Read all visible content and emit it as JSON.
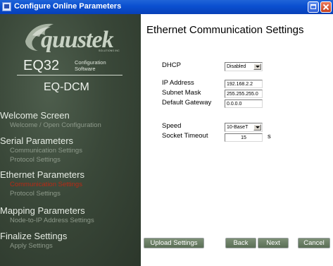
{
  "window": {
    "title": "Configure Online Parameters"
  },
  "sidebar": {
    "logo_text": "quustek",
    "logo_sub": "SOLUTIONS INC",
    "product_name": "EQ32",
    "product_sub_line1": "Configuration",
    "product_sub_line2": "Software",
    "device_name": "EQ-DCM",
    "groups": [
      {
        "header": "Welcome Screen",
        "items": [
          {
            "label": "Welcome / Open Configuration",
            "active": false
          }
        ]
      },
      {
        "header": "Serial Parameters",
        "items": [
          {
            "label": "Communication Settings",
            "active": false
          },
          {
            "label": "Protocol Settings",
            "active": false
          }
        ]
      },
      {
        "header": "Ethernet Parameters",
        "items": [
          {
            "label": "Communication Settings",
            "active": true
          },
          {
            "label": "Protocol Settings",
            "active": false
          }
        ]
      },
      {
        "header": "Mapping Parameters",
        "items": [
          {
            "label": "Node-to-IP Address Settings",
            "active": false
          }
        ]
      },
      {
        "header": "Finalize Settings",
        "items": [
          {
            "label": "Apply Settings",
            "active": false
          }
        ]
      }
    ]
  },
  "main": {
    "title": "Ethernet Communication Settings",
    "dhcp": {
      "label": "DHCP",
      "value": "Disabled"
    },
    "ip_address": {
      "label": "IP Address",
      "value": "192.168.2.2"
    },
    "subnet_mask": {
      "label": "Subnet Mask",
      "value": "255.255.255.0"
    },
    "default_gateway": {
      "label": "Default Gateway",
      "value": "0.0.0.0"
    },
    "speed": {
      "label": "Speed",
      "value": "10-BaseT"
    },
    "socket_timeout": {
      "label": "Socket Timeout",
      "value": "15",
      "unit": "s"
    }
  },
  "buttons": {
    "upload": "Upload Settings",
    "back": "Back",
    "next": "Next",
    "cancel": "Cancel"
  },
  "colors": {
    "titlebar": "#0a4fd0",
    "sidebar_bg": "#3a4839",
    "active_nav": "#b82a16",
    "button_bg": "#6b7f65"
  }
}
